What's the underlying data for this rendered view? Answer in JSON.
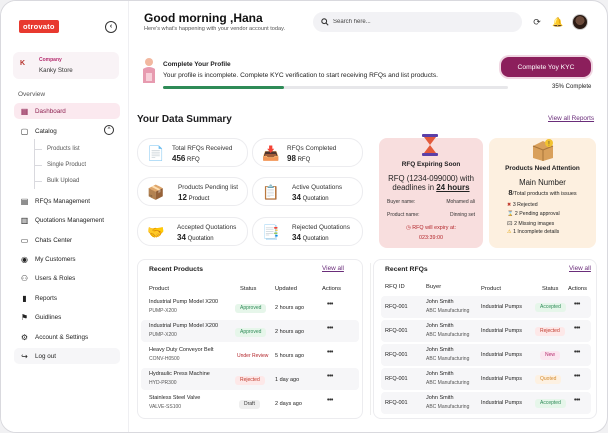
{
  "sidebar": {
    "logo": "otrovato",
    "collapse_glyph": "‹",
    "store": {
      "label": "Company",
      "name": "Kanky Store",
      "icon": "K"
    },
    "section": "Overview",
    "items": [
      {
        "label": "Dashboard",
        "icon": "▦"
      },
      {
        "label": "Catalog",
        "icon": "▢"
      },
      {
        "label": "RFQs Management",
        "icon": "▤"
      },
      {
        "label": "Quotations  Management",
        "icon": "▥"
      },
      {
        "label": "Chats Center",
        "icon": "▭"
      },
      {
        "label": "My Customers",
        "icon": "◉"
      },
      {
        "label": "Users & Roles",
        "icon": "⚇"
      },
      {
        "label": "Reports",
        "icon": "▮"
      },
      {
        "label": "Guidlines",
        "icon": "⚑"
      },
      {
        "label": "Account & Settings",
        "icon": "⚙"
      },
      {
        "label": "Log out",
        "icon": "↪"
      }
    ],
    "catalog_sub": [
      "Products list",
      "Single Product",
      "Bulk Upload"
    ],
    "catalog_toggle": "^"
  },
  "header": {
    "greeting": "Good morning ,Hana",
    "subtitle": "Here's what's happening with your vendor account today.",
    "search_placeholder": "Search here...",
    "icons": [
      "refresh-icon",
      "bell-icon",
      "avatar"
    ]
  },
  "profile": {
    "title": "Complete Your Profile",
    "text": "Your profile is incomplete. Complete KYC verification to start receiving RFQs and list products.",
    "progress": 0.35,
    "progress_label": "35% Complete",
    "button": "Complete Yoy KYC"
  },
  "summary": {
    "title": "Your Data Summary",
    "link": "View all Reports",
    "stats": [
      {
        "label": "Total RFQs Received",
        "value": "456",
        "unit": "RFQ",
        "icon": "📄"
      },
      {
        "label": "RFQs Completed",
        "value": "98",
        "unit": "RFQ",
        "icon": "📥"
      },
      {
        "label": "Products Pending list",
        "value": "12",
        "unit": "Product",
        "icon": "📦"
      },
      {
        "label": "Active Quotations",
        "value": "34",
        "unit": "Quotation",
        "icon": "📋"
      },
      {
        "label": "Accepted Quotations",
        "value": "34",
        "unit": "Quotation",
        "icon": "🤝"
      },
      {
        "label": "Rejected Quotations",
        "value": "34",
        "unit": "Quotation",
        "icon": "📑"
      }
    ],
    "rfq_expiring": {
      "title": "RFQ Expiring Soon",
      "rfq": "RFQ (1234-099000) with",
      "deadline_prefix": "deadlines in",
      "deadline": "24 hours",
      "buyer_label": "Buyer name:",
      "buyer": "Mohamed ali",
      "product_label": "Product name:",
      "product": "Dinning set",
      "expiry_label": "RFQ will expiry at:",
      "expiry_time": "023:39:00"
    },
    "attention": {
      "title": "Products Need Attention",
      "main": "Main Number",
      "total_value": "8",
      "total_label": "/Total products with issues",
      "items": [
        {
          "glyph": "✖",
          "text": "3 Rejected",
          "color": "#c0392b"
        },
        {
          "glyph": "⌛",
          "text": "2 Pending approval",
          "color": "#555555"
        },
        {
          "glyph": "🖾",
          "text": "2 Missing images",
          "color": "#555555"
        },
        {
          "glyph": "⚠",
          "text": "1 Incomplete details",
          "color": "#e0a000"
        }
      ]
    }
  },
  "recent_products": {
    "title": "Recent Products",
    "link": "View all",
    "headers": [
      "Product",
      "Status",
      "Updated",
      "Actions"
    ],
    "rows": [
      {
        "name": "Industrial Pump Model X200",
        "code": "PUMP-X200",
        "status": "Approved",
        "updated": "2 hours ago"
      },
      {
        "name": "Industrial Pump Model X200",
        "code": "PUMP-X200",
        "status": "Approved",
        "updated": "2 hours ago"
      },
      {
        "name": "Heavy Duty Conveyor Belt",
        "code": "CONV-H0500",
        "status": "Under Review",
        "updated": "5 hours ago"
      },
      {
        "name": "Hydraulic Press Machine",
        "code": "HYD-PR300",
        "status": "Rejected",
        "updated": "1 day ago"
      },
      {
        "name": "Stainless Steel Valve",
        "code": "VALVE-SS100",
        "status": "Draft",
        "updated": "2 days ago"
      }
    ]
  },
  "recent_rfqs": {
    "title": "Recent RFQs",
    "link": "View all",
    "headers": [
      "RFQ ID",
      "Buyer",
      "Product",
      "Status",
      "Actions"
    ],
    "rows": [
      {
        "id": "RFQ-001",
        "buyer": "John Smith",
        "company": "ABC Manufacturing",
        "product": "Industrial Pumps",
        "status": "Accepted"
      },
      {
        "id": "RFQ-001",
        "buyer": "John Smith",
        "company": "ABC Manufacturing",
        "product": "Industrial Pumps",
        "status": "Rejected"
      },
      {
        "id": "RFQ-001",
        "buyer": "John Smith",
        "company": "ABC Manufacturing",
        "product": "Industrial Pumps",
        "status": "New"
      },
      {
        "id": "RFQ-001",
        "buyer": "John Smith",
        "company": "ABC Manufacturing",
        "product": "Industrial Pumps",
        "status": "Quoted"
      },
      {
        "id": "RFQ-001",
        "buyer": "John Smith",
        "company": "ABC Manufacturing",
        "product": "Industrial Pumps",
        "status": "Accepted"
      }
    ]
  },
  "actions_glyph": "•••",
  "colors": {
    "brand": "#8c1f5c",
    "logo": "#e8392f",
    "progress": "#2e8b57",
    "rfq_card": "#f8dede",
    "attention_card": "#fdf0e0"
  }
}
